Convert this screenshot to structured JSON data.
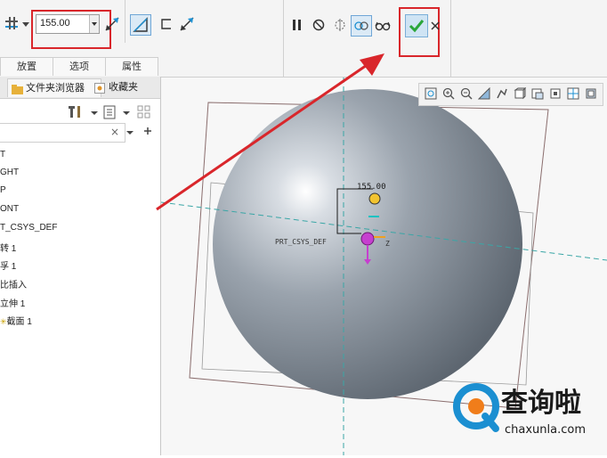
{
  "toolbar": {
    "depth_value": "155.00",
    "accent": "#1b8fd1",
    "confirm_color": "#2aa63a",
    "highlight_color": "#d9262b"
  },
  "tabs": [
    {
      "label": "放置"
    },
    {
      "label": "选项"
    },
    {
      "label": "属性"
    }
  ],
  "panel": {
    "tabs": [
      {
        "label": "文件夹浏览器"
      },
      {
        "label": "收藏夹"
      }
    ],
    "tree": [
      {
        "label": "T"
      },
      {
        "label": "GHT"
      },
      {
        "label": "P"
      },
      {
        "label": "ONT"
      },
      {
        "label": "T_CSYS_DEF"
      },
      {
        "label": "转 1"
      },
      {
        "label": "孚 1"
      },
      {
        "label": "比插入"
      },
      {
        "label": "立伸 1"
      },
      {
        "label": "截面 1"
      }
    ]
  },
  "model": {
    "dim_label": "155.00",
    "csys_label": "PRT_CSYS_DEF",
    "z_label": "Z"
  },
  "watermark": {
    "title": "查询啦",
    "url": "chaxunla.com"
  }
}
